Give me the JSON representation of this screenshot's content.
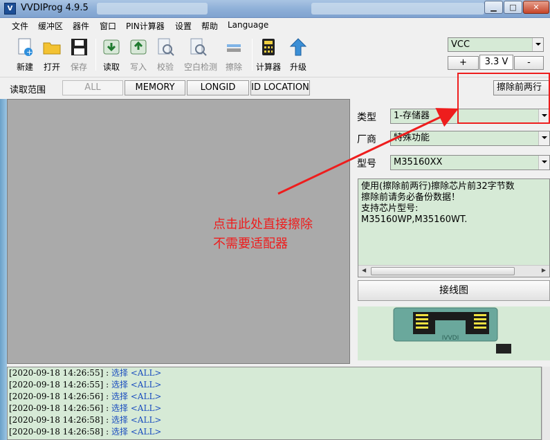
{
  "window": {
    "title": "VVDIProg 4.9.5"
  },
  "menu": [
    "文件",
    "缓冲区",
    "器件",
    "窗口",
    "PIN计算器",
    "设置",
    "帮助",
    "Language"
  ],
  "toolbar": {
    "new": "新建",
    "open": "打开",
    "save": "保存",
    "read": "读取",
    "write": "写入",
    "verify": "校验",
    "blank_check": "空白检测",
    "erase": "擦除",
    "calculator": "计算器",
    "upgrade": "升级"
  },
  "power": {
    "select": "VCC",
    "plus": "+",
    "voltage": "3.3 V",
    "minus": "-"
  },
  "read_range": {
    "label": "读取范围",
    "buttons": [
      "ALL",
      "MEMORY",
      "LONGID",
      "ID LOCATION"
    ],
    "selected": "ALL"
  },
  "erase_two_button": "擦除前两行",
  "device": {
    "type_label": "类型",
    "type_value": "1-存储器",
    "vendor_label": "厂商",
    "vendor_value": "特殊功能",
    "model_label": "型号",
    "model_value": "M35160XX"
  },
  "description": "使用(擦除前两行)擦除芯片前32字节数\n擦除前请务必备份数据！\n支持芯片型号:\nM35160WP,M35160WT.",
  "wiring_button": "接线图",
  "chip_label": "IVVDI",
  "log": [
    {
      "ts": "[2020-09-18 14:26:55] : ",
      "msg": "选择 <ALL>"
    },
    {
      "ts": "[2020-09-18 14:26:55] : ",
      "msg": "选择 <ALL>"
    },
    {
      "ts": "[2020-09-18 14:26:56] : ",
      "msg": "选择 <ALL>"
    },
    {
      "ts": "[2020-09-18 14:26:56] : ",
      "msg": "选择 <ALL>"
    },
    {
      "ts": "[2020-09-18 14:26:58] : ",
      "msg": "选择 <ALL>"
    },
    {
      "ts": "[2020-09-18 14:26:58] : ",
      "msg": "选择 <ALL>"
    }
  ],
  "annotation": "点击此处直接擦除\n不需要适配器",
  "colors": {
    "annotation": "#ee1d1d",
    "panel_green": "#d6ead6",
    "hex_gray": "#aaaaaa",
    "log_blue": "#1a4dbf"
  }
}
